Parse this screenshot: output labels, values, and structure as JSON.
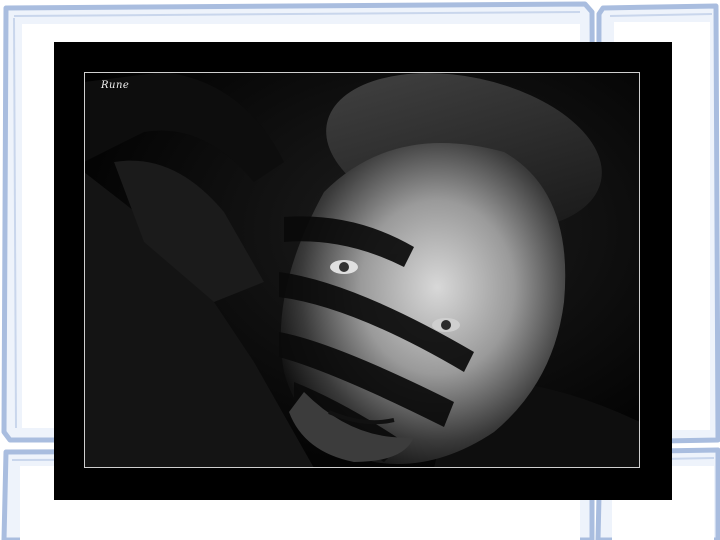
{
  "slide": {
    "background_color": "#ffffff",
    "frame_color": "#a9bddf",
    "frame_fill": "#eef3fb"
  },
  "photo": {
    "signature_text": "Rune",
    "style": "black-and-white portrait",
    "border_color": "#cfcfcf"
  }
}
